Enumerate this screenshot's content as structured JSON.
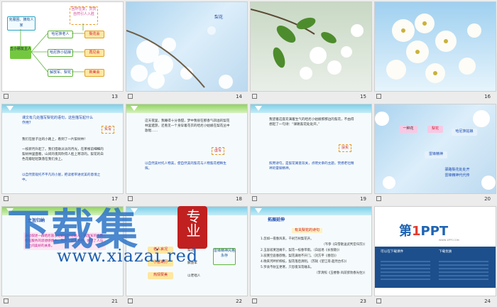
{
  "slides": [
    {
      "num": "13"
    },
    {
      "num": "14",
      "label": "梨花"
    },
    {
      "num": "15"
    },
    {
      "num": "16"
    },
    {
      "num": "17"
    },
    {
      "num": "18"
    },
    {
      "num": "19"
    },
    {
      "num": "20"
    },
    {
      "num": "21"
    },
    {
      "num": "22"
    },
    {
      "num": "23"
    },
    {
      "num": "24"
    }
  ],
  "s13": {
    "root": "克服困、摘有人家",
    "hub": "五小朋友主人",
    "top": "回环往复，赏赏自然引人入胜",
    "l1": "哈尼族老人",
    "l2": "哈尼族小姑娘",
    "l3": "解放军、梨花",
    "r1": "梨花会",
    "r2": "再见会",
    "r3": "新美会"
  },
  "s17": {
    "q": "课文有几处描写梨花的语句，这些描写起什么作用？",
    "tag": "实写",
    "p1": "我们在屋子边的小路上，看到了一片梨树林！",
    "p2": "一枝新月升起了。我们借助淡淡的月光，在茶根前细细的梨树林里面看，山间的夜风吹得人脸上寒凉的。梨花的白色花瓣轻轻飘落在我们身上。",
    "p3": "以自然景观托不平凡的小屋，把读者带进优美的意境之中。"
  },
  "s18": {
    "p1": "这天夜里，我睡得十分香甜，梦中我很在那香气四溢的梨花林里遨游，还看见一个身穿着花衣的哈尼小姑娘在梨花丛中歌唱……",
    "tag": "虚写",
    "p2": "以自然美衬托人物美，使自然美的梨花与人物梨花相映生辉。"
  },
  "s19": {
    "p1": "我望着这座充满着生气的哈尼小姑娘那那边的梨花，不由得想起了一句诗：“驿路梨花处处开。”",
    "tag": "扶实",
    "p2": "照用诗句，是梨花寓意双关，点明文章的主题，赞扬老社精神的雷锋精神。"
  },
  "s20": {
    "b1": "一种花",
    "b2": "梨花",
    "b3": "哈尼族姑娘",
    "b4": "雷锋精神",
    "f1": "驿路梨花处处开",
    "f2": "雷锋精神代代传"
  },
  "s21": {
    "title": "主旨归纳",
    "body": "通过叙述一群哈尼族小姑娘照料过路人，解放军的人民都在服务的思想感情中，歌颂了雷锋精神，体现了人与人之间美好的关系。"
  },
  "s22": {
    "a": "老人哀况",
    "a2": "梨花",
    "b": "小屋来历",
    "b2": "解放军",
    "c": "热情赞美",
    "c2": "以老唱人",
    "right": "雷锋精神风格永存"
  },
  "s23": {
    "title": "拓展延伸",
    "sub": "有关梨花的诗句",
    "lines": [
      "1.忽如一夜春风来，千树万树梨花开。",
      "（岑参《白雪歌送武判官归京》）",
      "2.玉容寂寞泪阑干，梨花一枝春带雨。（白居易《长恨歌》）",
      "3.寂寞空庭春欲晚，梨花满地不开门。（刘方平《春怨》）",
      "4.晚来河畔折柳枝，梨花落后清明。（苏轼《望江南·超然台作》）",
      "5.罗衾不耐五更寒，只恐夜深花睡去。",
      "（李清照《玉楼春·风前欲劝春光住》）"
    ]
  },
  "s24": {
    "logo1": "第",
    "logo2": "1",
    "logo3": "PPT",
    "tagline": "WWW.1PPT.COM",
    "c1": "可以在下载课件",
    "c2": "下载优质"
  },
  "watermark": {
    "main": "下载集",
    "seal": "专业",
    "url": "www.xiazai.red"
  }
}
